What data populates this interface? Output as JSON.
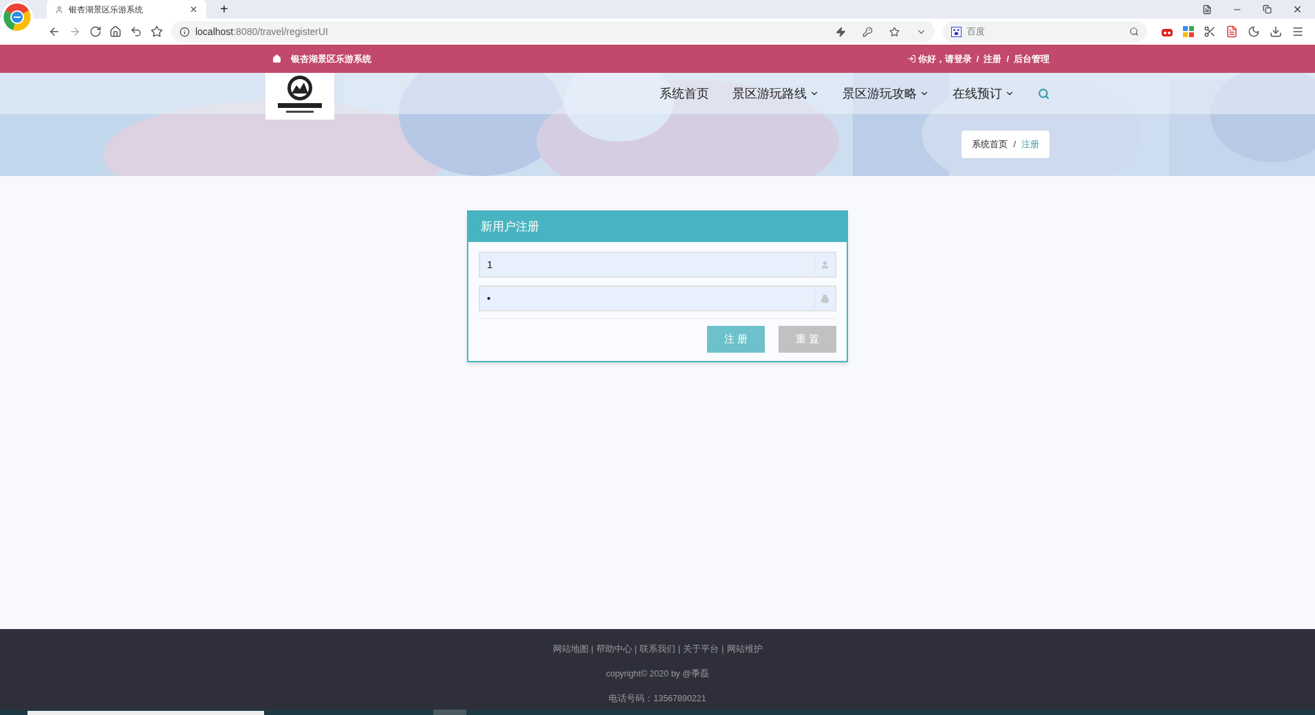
{
  "browser": {
    "tab_title": "银杏湖景区乐游系统",
    "tab_add": "+",
    "url_host": "localhost",
    "url_rest": ":8080/travel/registerUI",
    "search_placeholder": "百度"
  },
  "topbar": {
    "site_name": "银杏湖景区乐游系统",
    "links": [
      {
        "label": "你好，请登录"
      },
      {
        "label": "注册"
      },
      {
        "label": "后台管理"
      }
    ],
    "separator": "/"
  },
  "nav": {
    "items": [
      {
        "label": "系统首页",
        "dropdown": false
      },
      {
        "label": "景区游玩路线",
        "dropdown": true
      },
      {
        "label": "景区游玩攻略",
        "dropdown": true
      },
      {
        "label": "在线预订",
        "dropdown": true
      }
    ]
  },
  "breadcrumb": {
    "items": [
      {
        "label": "系统首页",
        "selected": false
      },
      {
        "label": "注册",
        "selected": true
      }
    ],
    "separator": "/"
  },
  "form": {
    "title": "新用户注册",
    "fields": [
      {
        "kind": "text",
        "value": "1"
      },
      {
        "kind": "password",
        "value": "•"
      }
    ],
    "buttons": [
      {
        "label": "注 册",
        "kind": "primary"
      },
      {
        "label": "重 置",
        "kind": "secondary"
      }
    ]
  },
  "footer": {
    "links": [
      "网站地图",
      "帮助中心",
      "联系我们",
      "关于平台",
      "网站维护"
    ],
    "link_separator": "|",
    "copyright": "copyright© 2020 by @季磊",
    "phone": "电话号码：13567890221"
  }
}
